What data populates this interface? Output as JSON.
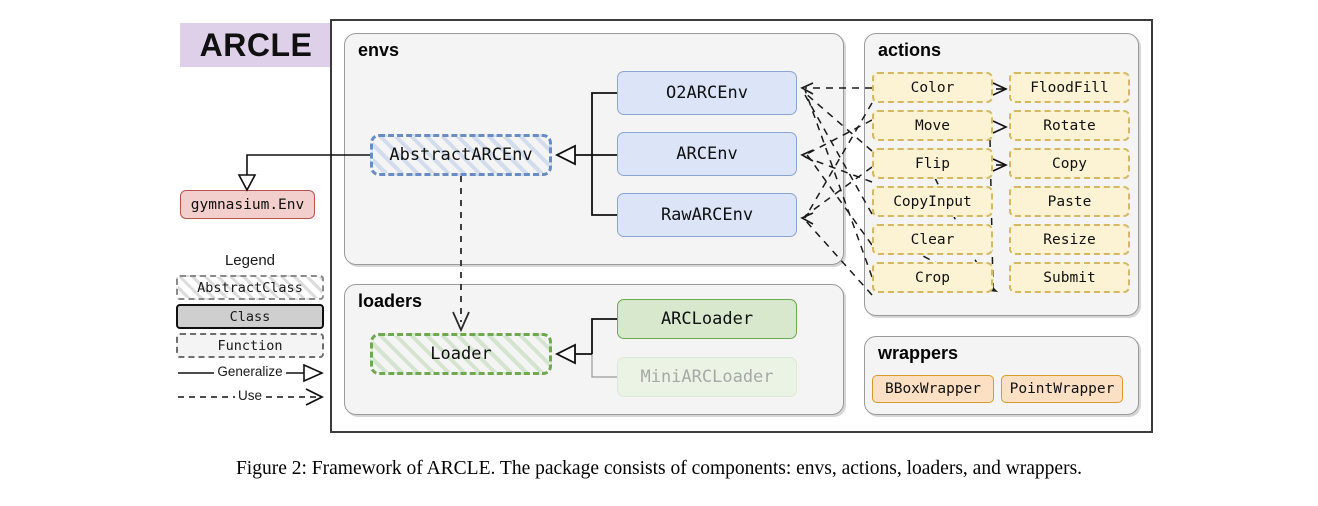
{
  "logo": {
    "text": "ARCLE"
  },
  "external": {
    "gym_env": "gymnasium.Env"
  },
  "legend": {
    "title": "Legend",
    "abstract_class": "AbstractClass",
    "klass": "Class",
    "function": "Function",
    "generalize": "Generalize",
    "use": "Use"
  },
  "panels": {
    "envs": {
      "title": "envs"
    },
    "loaders": {
      "title": "loaders"
    },
    "actions": {
      "title": "actions"
    },
    "wrappers": {
      "title": "wrappers"
    }
  },
  "envs": {
    "abstract": "AbstractARCEnv",
    "classes": [
      "O2ARCEnv",
      "ARCEnv",
      "RawARCEnv"
    ]
  },
  "loaders": {
    "abstract": "Loader",
    "classes": [
      "ARCLoader",
      "MiniARCLoader"
    ]
  },
  "actions": {
    "items": [
      "Color",
      "FloodFill",
      "Move",
      "Rotate",
      "Flip",
      "Copy",
      "CopyInput",
      "Paste",
      "Clear",
      "Resize",
      "Crop",
      "Submit"
    ]
  },
  "wrappers": {
    "items": [
      "BBoxWrapper",
      "PointWrapper"
    ]
  },
  "caption": {
    "text": "Figure 2: Framework of ARCLE. The package consists of components: envs, actions, loaders, and wrappers."
  },
  "colors": {
    "logo_bg": "#ded0e8",
    "env_box": "#dbe5f7",
    "env_border": "#8ba4d4",
    "loader_box": "#d7e8cd",
    "loader_border": "#6ea84f",
    "action_box": "#fcf3d4",
    "action_border": "#d4b863",
    "wrapper_box": "#fbe0c4",
    "wrapper_border": "#d79b2b",
    "gym_box": "#f2cfcc",
    "gym_border": "#b85450",
    "panel_bg": "#f4f4f4"
  }
}
